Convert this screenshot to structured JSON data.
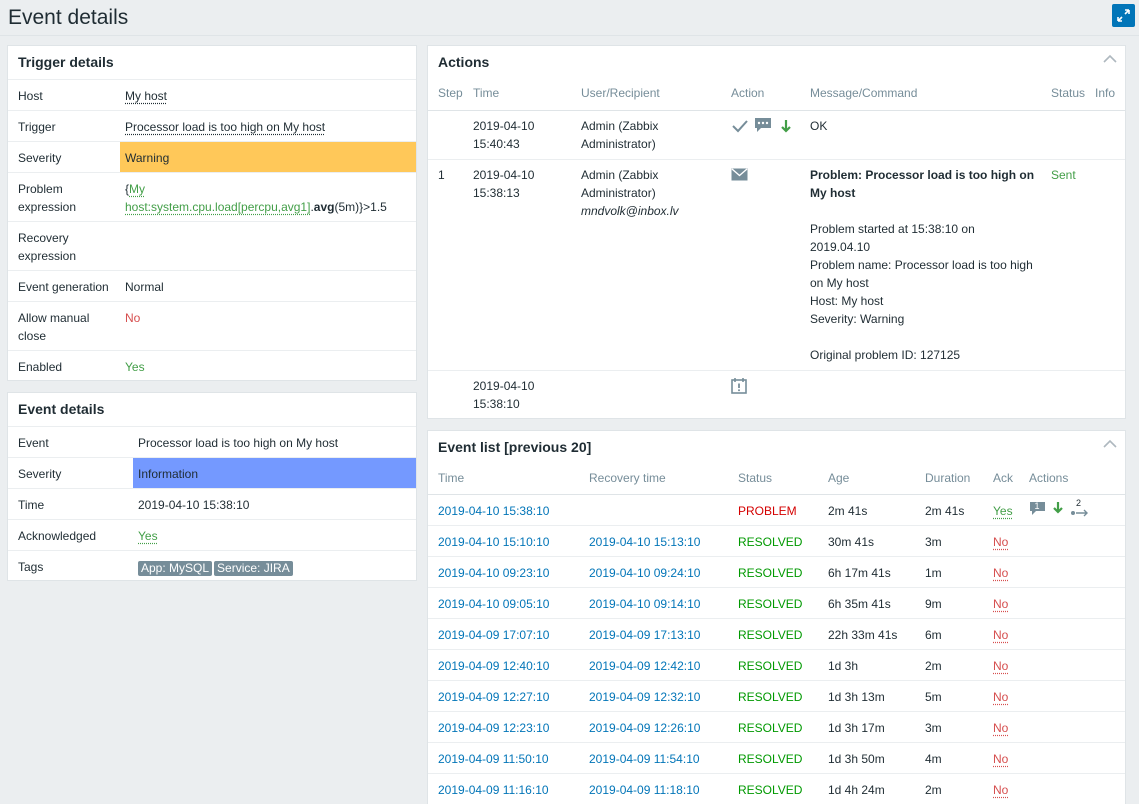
{
  "page": {
    "title": "Event details"
  },
  "trigger_details": {
    "title": "Trigger details",
    "rows": {
      "host": {
        "label": "Host",
        "value": "My host"
      },
      "trigger": {
        "label": "Trigger",
        "value": "Processor load is too high on My host"
      },
      "severity": {
        "label": "Severity",
        "value": "Warning",
        "color": "#ffc859"
      },
      "problem_expression": {
        "label": "Problem expression",
        "open": "{",
        "item": "My host:system.cpu.load[percpu,avg1]",
        "fn_sep": ".",
        "fn": "avg",
        "arg": "(5m)",
        "close": "}",
        "rest": ">1.5"
      },
      "recovery_expression": {
        "label": "Recovery expression",
        "value": ""
      },
      "event_generation": {
        "label": "Event generation",
        "value": "Normal"
      },
      "allow_manual_close": {
        "label": "Allow manual close",
        "value": "No"
      },
      "enabled": {
        "label": "Enabled",
        "value": "Yes"
      }
    }
  },
  "event_details": {
    "title": "Event details",
    "rows": {
      "event": {
        "label": "Event",
        "value": "Processor load is too high on My host"
      },
      "severity": {
        "label": "Severity",
        "value": "Information",
        "color": "#7499ff"
      },
      "time": {
        "label": "Time",
        "value": "2019-04-10 15:38:10"
      },
      "acknowledged": {
        "label": "Acknowledged",
        "value": "Yes"
      },
      "tags": {
        "label": "Tags",
        "items": [
          "App: MySQL",
          "Service: JIRA"
        ]
      }
    }
  },
  "actions": {
    "title": "Actions",
    "columns": [
      "Step",
      "Time",
      "User/Recipient",
      "Action",
      "Message/Command",
      "Status",
      "Info"
    ],
    "rows": [
      {
        "step": "",
        "date": "2019-04-10",
        "time": "15:40:43",
        "user1": "Admin (Zabbix",
        "user2": "Administrator)",
        "user3": "",
        "icons": [
          "check-icon",
          "comment-icon",
          "arrow-down-icon"
        ],
        "message_bold": "",
        "message": "OK",
        "status": ""
      },
      {
        "step": "1",
        "date": "2019-04-10",
        "time": "15:38:13",
        "user1": "Admin (Zabbix",
        "user2": "Administrator)",
        "user3": "mndvolk@inbox.lv",
        "icons": [
          "envelope-icon"
        ],
        "message_bold": [
          "Problem: Processor load is too high on",
          "My host"
        ],
        "message_lines": [
          "Problem started at 15:38:10 on",
          "2019.04.10",
          "Problem name: Processor load is too high",
          "on My host",
          "Host: My host",
          "Severity: Warning",
          "",
          "Original problem ID: 127125"
        ],
        "status": "Sent"
      },
      {
        "step": "",
        "date": "2019-04-10",
        "time": "15:38:10",
        "icons": [
          "calendar-alert-icon"
        ]
      }
    ]
  },
  "event_list": {
    "title": "Event list [previous 20]",
    "columns": [
      "Time",
      "Recovery time",
      "Status",
      "Age",
      "Duration",
      "Ack",
      "Actions"
    ],
    "rows": [
      {
        "time": "2019-04-10 15:38:10",
        "recovery": "",
        "status": "PROBLEM",
        "age": "2m 41s",
        "duration": "2m 41s",
        "ack": "Yes",
        "actions_badge": "1",
        "actions_count": "2"
      },
      {
        "time": "2019-04-10 15:10:10",
        "recovery": "2019-04-10 15:13:10",
        "status": "RESOLVED",
        "age": "30m 41s",
        "duration": "3m",
        "ack": "No"
      },
      {
        "time": "2019-04-10 09:23:10",
        "recovery": "2019-04-10 09:24:10",
        "status": "RESOLVED",
        "age": "6h 17m 41s",
        "duration": "1m",
        "ack": "No"
      },
      {
        "time": "2019-04-10 09:05:10",
        "recovery": "2019-04-10 09:14:10",
        "status": "RESOLVED",
        "age": "6h 35m 41s",
        "duration": "9m",
        "ack": "No"
      },
      {
        "time": "2019-04-09 17:07:10",
        "recovery": "2019-04-09 17:13:10",
        "status": "RESOLVED",
        "age": "22h 33m 41s",
        "duration": "6m",
        "ack": "No"
      },
      {
        "time": "2019-04-09 12:40:10",
        "recovery": "2019-04-09 12:42:10",
        "status": "RESOLVED",
        "age": "1d 3h",
        "duration": "2m",
        "ack": "No"
      },
      {
        "time": "2019-04-09 12:27:10",
        "recovery": "2019-04-09 12:32:10",
        "status": "RESOLVED",
        "age": "1d 3h 13m",
        "duration": "5m",
        "ack": "No"
      },
      {
        "time": "2019-04-09 12:23:10",
        "recovery": "2019-04-09 12:26:10",
        "status": "RESOLVED",
        "age": "1d 3h 17m",
        "duration": "3m",
        "ack": "No"
      },
      {
        "time": "2019-04-09 11:50:10",
        "recovery": "2019-04-09 11:54:10",
        "status": "RESOLVED",
        "age": "1d 3h 50m",
        "duration": "4m",
        "ack": "No"
      },
      {
        "time": "2019-04-09 11:16:10",
        "recovery": "2019-04-09 11:18:10",
        "status": "RESOLVED",
        "age": "1d 4h 24m",
        "duration": "2m",
        "ack": "No"
      }
    ]
  }
}
